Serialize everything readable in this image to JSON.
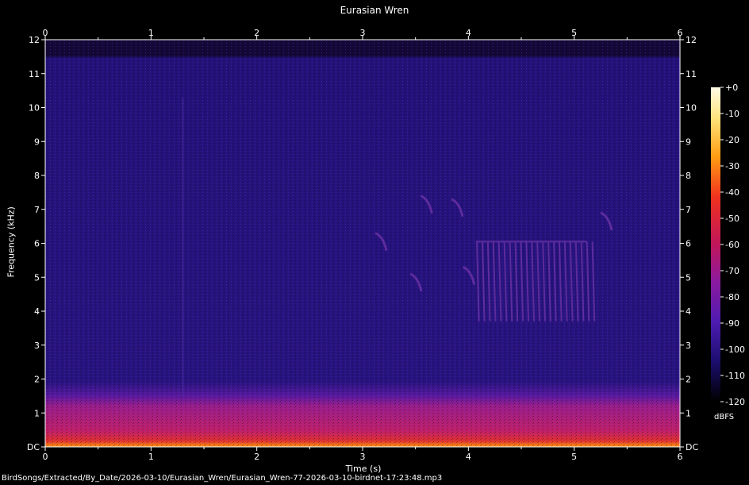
{
  "chart_data": {
    "type": "heatmap",
    "title": "Eurasian Wren",
    "xlabel": "Time (s)",
    "ylabel": "Frequency (kHz)",
    "xlim": [
      0,
      6
    ],
    "ylim": [
      0,
      12
    ],
    "x_ticks": [
      "0",
      "1",
      "2",
      "3",
      "4",
      "5",
      "6"
    ],
    "y_ticks": [
      "DC",
      "1",
      "2",
      "3",
      "4",
      "5",
      "6",
      "7",
      "8",
      "9",
      "10",
      "11",
      "12"
    ],
    "colorbar": {
      "label": "dBFS",
      "ticks": [
        "+0",
        "-10",
        "-20",
        "-30",
        "-40",
        "-50",
        "-60",
        "-70",
        "-80",
        "-90",
        "-100",
        "-110",
        "-120"
      ],
      "range": [
        -120,
        0
      ]
    },
    "grid": false,
    "colormap": "magma-like",
    "background_level_dbfs": -95,
    "low_band_level_dbfs": -60,
    "low_band_khz": [
      0,
      1.6
    ],
    "noise_cutoff_khz": 11.6
  },
  "footer_path": "BirdSongs/Extracted/By_Date/2026-03-10/Eurasian_Wren/Eurasian_Wren-77-2026-03-10-birdnet-17:23:48.mp3"
}
